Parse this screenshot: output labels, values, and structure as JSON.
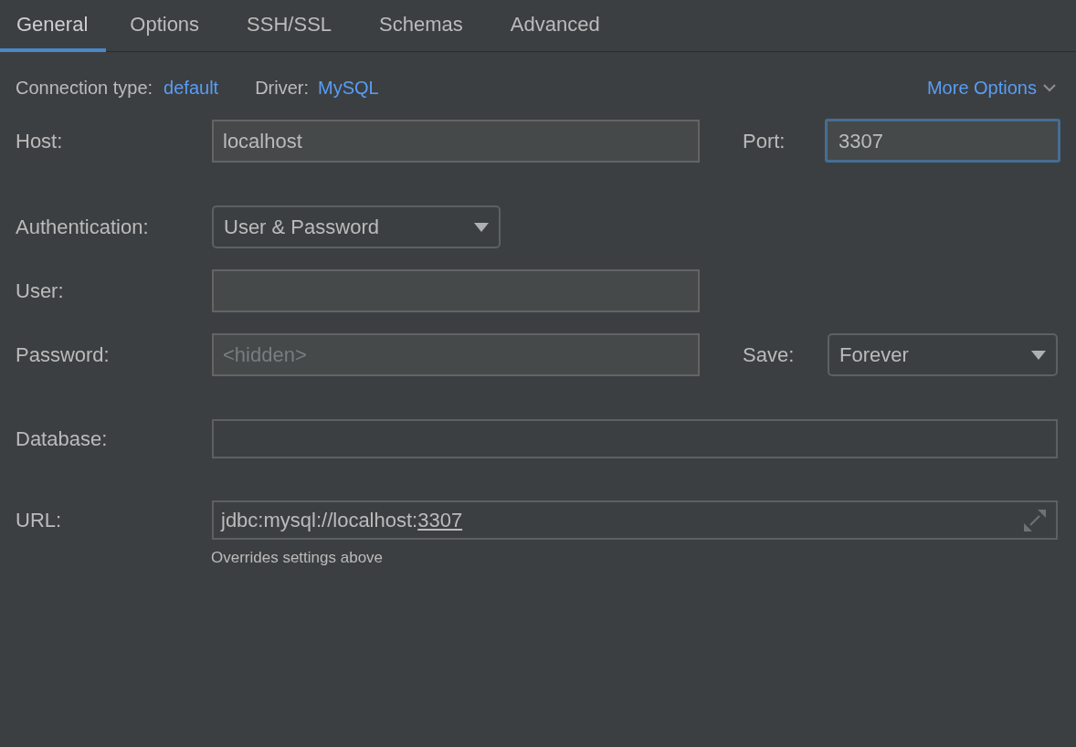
{
  "tabs": [
    {
      "label": "General",
      "selected": true
    },
    {
      "label": "Options",
      "selected": false
    },
    {
      "label": "SSH/SSL",
      "selected": false
    },
    {
      "label": "Schemas",
      "selected": false
    },
    {
      "label": "Advanced",
      "selected": false
    }
  ],
  "connection": {
    "type_label": "Connection type:",
    "type_value": "default",
    "driver_label": "Driver:",
    "driver_value": "MySQL",
    "more_options": "More Options"
  },
  "host": {
    "label": "Host:",
    "value": "localhost"
  },
  "port": {
    "label": "Port:",
    "value": "3307",
    "focused": true
  },
  "authentication": {
    "label": "Authentication:",
    "value": "User & Password"
  },
  "user": {
    "label": "User:"
  },
  "password": {
    "label": "Password:",
    "placeholder": "<hidden>"
  },
  "save": {
    "label": "Save:",
    "value": "Forever"
  },
  "database": {
    "label": "Database:"
  },
  "url": {
    "label": "URL:",
    "value": "jdbc:mysql://localhost:",
    "underlined_part": "3307",
    "hint": "Overrides settings above"
  }
}
